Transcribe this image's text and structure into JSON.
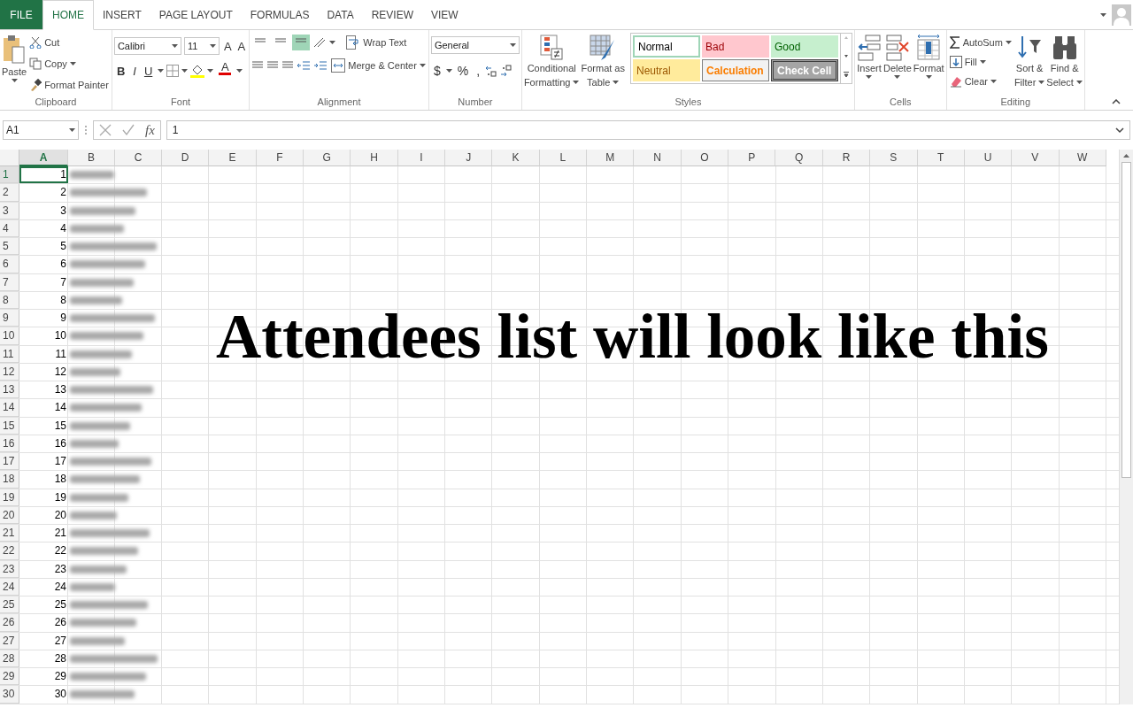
{
  "tabs": [
    {
      "label": "FILE",
      "kind": "file",
      "selected": false
    },
    {
      "label": "HOME",
      "kind": "tab",
      "selected": true
    },
    {
      "label": "INSERT",
      "kind": "tab",
      "selected": false
    },
    {
      "label": "PAGE LAYOUT",
      "kind": "tab",
      "selected": false
    },
    {
      "label": "FORMULAS",
      "kind": "tab",
      "selected": false
    },
    {
      "label": "DATA",
      "kind": "tab",
      "selected": false
    },
    {
      "label": "REVIEW",
      "kind": "tab",
      "selected": false
    },
    {
      "label": "VIEW",
      "kind": "tab",
      "selected": false
    }
  ],
  "clipboard": {
    "label": "Clipboard",
    "paste": "Paste",
    "items": [
      {
        "label": "Cut",
        "kind": "cut"
      },
      {
        "label": "Copy",
        "kind": "copy"
      },
      {
        "label": "Format Painter",
        "kind": "painter"
      }
    ]
  },
  "font": {
    "label": "Font",
    "font_name": "Calibri",
    "font_size": "11",
    "size_buttons": [
      "A",
      "A"
    ],
    "styles": [
      "B",
      "I",
      "U"
    ],
    "font_color": "A"
  },
  "alignment": {
    "label": "Alignment",
    "vertical_buttons": [
      {
        "selected": false
      },
      {
        "selected": false
      },
      {
        "selected": true
      }
    ],
    "wrap": "Wrap Text",
    "merge": "Merge & Center"
  },
  "number": {
    "label": "Number",
    "format": "General",
    "symbols": [
      "$",
      "%",
      ","
    ]
  },
  "styles": {
    "label": "Styles",
    "big_buttons": [
      {
        "lines": [
          "Conditional",
          "Formatting"
        ],
        "kind": "conditional"
      },
      {
        "lines": [
          "Format as",
          "Table"
        ],
        "kind": "table"
      }
    ],
    "cell_styles": [
      {
        "label": "Normal",
        "kind": "normal"
      },
      {
        "label": "Bad",
        "kind": "bad"
      },
      {
        "label": "Good",
        "kind": "good"
      },
      {
        "label": "Neutral",
        "kind": "neutral"
      },
      {
        "label": "Calculation",
        "kind": "calculation"
      },
      {
        "label": "Check Cell",
        "kind": "check"
      }
    ]
  },
  "cells": {
    "label": "Cells",
    "buttons": [
      {
        "label": "Insert",
        "kind": "insert"
      },
      {
        "label": "Delete",
        "kind": "delete"
      },
      {
        "label": "Format",
        "kind": "format"
      }
    ]
  },
  "editing": {
    "label": "Editing",
    "items": [
      {
        "label": "AutoSum",
        "kind": "autosum"
      },
      {
        "label": "Fill",
        "kind": "fill"
      },
      {
        "label": "Clear",
        "kind": "clear"
      }
    ],
    "big_buttons": [
      {
        "lines": [
          "Sort &",
          "Filter"
        ],
        "kind": "sort"
      },
      {
        "lines": [
          "Find &",
          "Select"
        ],
        "kind": "find"
      }
    ]
  },
  "formula_bar": {
    "name_box": "A1",
    "fx": "fx",
    "value": "1"
  },
  "columns": [
    {
      "label": "A",
      "selected": true
    },
    {
      "label": "B",
      "selected": false
    },
    {
      "label": "C",
      "selected": false
    },
    {
      "label": "D",
      "selected": false
    },
    {
      "label": "E",
      "selected": false
    },
    {
      "label": "F",
      "selected": false
    },
    {
      "label": "G",
      "selected": false
    },
    {
      "label": "H",
      "selected": false
    },
    {
      "label": "I",
      "selected": false
    },
    {
      "label": "J",
      "selected": false
    },
    {
      "label": "K",
      "selected": false
    },
    {
      "label": "L",
      "selected": false
    },
    {
      "label": "M",
      "selected": false
    },
    {
      "label": "N",
      "selected": false
    },
    {
      "label": "O",
      "selected": false
    },
    {
      "label": "P",
      "selected": false
    },
    {
      "label": "Q",
      "selected": false
    },
    {
      "label": "R",
      "selected": false
    },
    {
      "label": "S",
      "selected": false
    },
    {
      "label": "T",
      "selected": false
    },
    {
      "label": "U",
      "selected": false
    },
    {
      "label": "V",
      "selected": false
    },
    {
      "label": "W",
      "selected": false
    }
  ],
  "rows": [
    {
      "header": "1",
      "a": "1",
      "b": {
        "kind": "blurred"
      },
      "selected": true
    },
    {
      "header": "2",
      "a": "2",
      "b": {
        "kind": "blurred"
      },
      "selected": false
    },
    {
      "header": "3",
      "a": "3",
      "b": {
        "kind": "blurred"
      },
      "selected": false
    },
    {
      "header": "4",
      "a": "4",
      "b": {
        "kind": "blurred"
      },
      "selected": false
    },
    {
      "header": "5",
      "a": "5",
      "b": {
        "kind": "blurred"
      },
      "selected": false
    },
    {
      "header": "6",
      "a": "6",
      "b": {
        "kind": "blurred"
      },
      "selected": false
    },
    {
      "header": "7",
      "a": "7",
      "b": {
        "kind": "blurred"
      },
      "selected": false
    },
    {
      "header": "8",
      "a": "8",
      "b": {
        "kind": "blurred"
      },
      "selected": false
    },
    {
      "header": "9",
      "a": "9",
      "b": {
        "kind": "blurred"
      },
      "selected": false
    },
    {
      "header": "10",
      "a": "10",
      "b": {
        "kind": "blurred"
      },
      "selected": false
    },
    {
      "header": "11",
      "a": "11",
      "b": {
        "kind": "blurred"
      },
      "selected": false
    },
    {
      "header": "12",
      "a": "12",
      "b": {
        "kind": "blurred"
      },
      "selected": false
    },
    {
      "header": "13",
      "a": "13",
      "b": {
        "kind": "blurred"
      },
      "selected": false
    },
    {
      "header": "14",
      "a": "14",
      "b": {
        "kind": "blurred"
      },
      "selected": false
    },
    {
      "header": "15",
      "a": "15",
      "b": {
        "kind": "blurred"
      },
      "selected": false
    },
    {
      "header": "16",
      "a": "16",
      "b": {
        "kind": "blurred"
      },
      "selected": false
    },
    {
      "header": "17",
      "a": "17",
      "b": {
        "kind": "blurred"
      },
      "selected": false
    },
    {
      "header": "18",
      "a": "18",
      "b": {
        "kind": "blurred"
      },
      "selected": false
    },
    {
      "header": "19",
      "a": "19",
      "b": {
        "kind": "blurred"
      },
      "selected": false
    },
    {
      "header": "20",
      "a": "20",
      "b": {
        "kind": "blurred"
      },
      "selected": false
    },
    {
      "header": "21",
      "a": "21",
      "b": {
        "kind": "blurred"
      },
      "selected": false
    },
    {
      "header": "22",
      "a": "22",
      "b": {
        "kind": "blurred"
      },
      "selected": false
    },
    {
      "header": "23",
      "a": "23",
      "b": {
        "kind": "blurred"
      },
      "selected": false
    },
    {
      "header": "24",
      "a": "24",
      "b": {
        "kind": "blurred"
      },
      "selected": false
    },
    {
      "header": "25",
      "a": "25",
      "b": {
        "kind": "blurred"
      },
      "selected": false
    },
    {
      "header": "26",
      "a": "26",
      "b": {
        "kind": "blurred"
      },
      "selected": false
    },
    {
      "header": "27",
      "a": "27",
      "b": {
        "kind": "blurred"
      },
      "selected": false
    },
    {
      "header": "28",
      "a": "28",
      "b": {
        "kind": "blurred"
      },
      "selected": false
    },
    {
      "header": "29",
      "a": "29",
      "b": {
        "kind": "blurred"
      },
      "selected": false
    },
    {
      "header": "30",
      "a": "30",
      "b": {
        "kind": "blurred"
      },
      "selected": false
    }
  ],
  "overlay_text": "Attendees list will look like this"
}
